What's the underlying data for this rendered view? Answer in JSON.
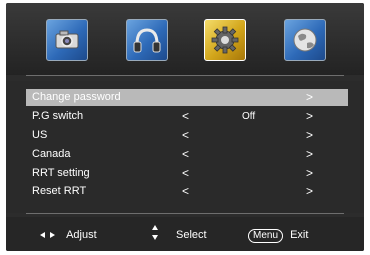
{
  "tabs": [
    {
      "icon": "camera-icon",
      "active": false
    },
    {
      "icon": "headphones-icon",
      "active": false
    },
    {
      "icon": "gear-icon",
      "active": true
    },
    {
      "icon": "globe-icon",
      "active": false
    }
  ],
  "menu": {
    "items": [
      {
        "label": "Change password",
        "value": "",
        "selected": true,
        "has_left_arrow": false
      },
      {
        "label": "P.G switch",
        "value": "Off",
        "selected": false,
        "has_left_arrow": true
      },
      {
        "label": "US",
        "value": "",
        "selected": false,
        "has_left_arrow": true
      },
      {
        "label": "Canada",
        "value": "",
        "selected": false,
        "has_left_arrow": true
      },
      {
        "label": "RRT setting",
        "value": "",
        "selected": false,
        "has_left_arrow": true
      },
      {
        "label": "Reset  RRT",
        "value": "",
        "selected": false,
        "has_left_arrow": true
      }
    ],
    "left_arrow": "<",
    "right_arrow": ">"
  },
  "footer": {
    "adjust_label": "Adjust",
    "select_label": "Select",
    "menu_key": "Menu",
    "exit_label": "Exit"
  },
  "colors": {
    "active_tab": "#d2a51a",
    "inactive_tab": "#2e6ab8",
    "selected_row": "#b9b9b9",
    "background": "#2a2a2a"
  }
}
